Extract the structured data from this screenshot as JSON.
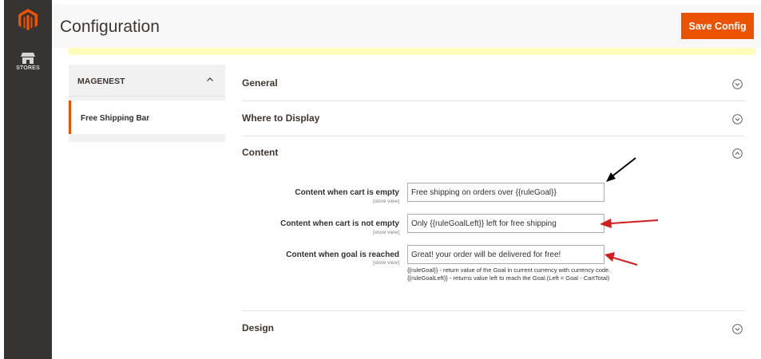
{
  "app": {
    "nav_label": "STORES",
    "logo_color": "#eb5202"
  },
  "header": {
    "title": "Configuration",
    "save_label": "Save Config"
  },
  "tabs": {
    "group_title": "MAGENEST",
    "items": [
      {
        "label": "Free Shipping Bar",
        "active": true
      }
    ]
  },
  "sections": [
    {
      "title": "General",
      "expanded": false
    },
    {
      "title": "Where to Display",
      "expanded": false
    },
    {
      "title": "Content",
      "expanded": true
    },
    {
      "title": "Design",
      "expanded": false
    }
  ],
  "content_fields": [
    {
      "label": "Content when cart is empty",
      "scope": "[store view]",
      "value": "Free shipping on orders over {{ruleGoal}}"
    },
    {
      "label": "Content when cart is not empty",
      "scope": "[store view]",
      "value": "Only {{ruleGoalLeft}} left for free shipping"
    },
    {
      "label": "Content when goal is reached",
      "scope": "[store view]",
      "value": "Great! your order will be delivered for free!"
    }
  ],
  "content_note": "{{ruleGoal}} - return value of the Goal in current currency with currency code. {{ruleGoalLeft}} - returns value left to reach the Goal.(Left = Goal - CartTotal)",
  "colors": {
    "accent": "#eb5202",
    "sidebar": "#373330",
    "annotation_red": "#d11f1f",
    "annotation_black": "#000000"
  }
}
